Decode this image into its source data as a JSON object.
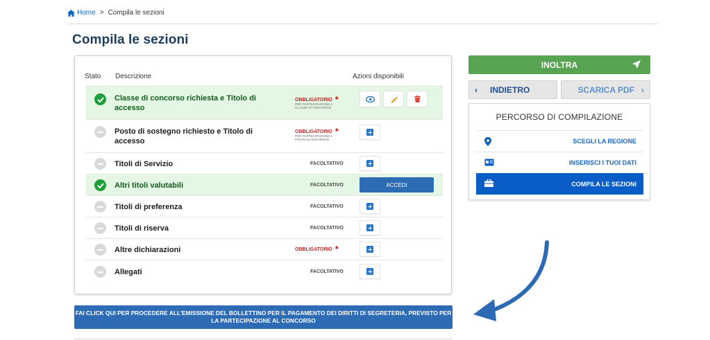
{
  "breadcrumb": {
    "home": "Home",
    "separator": ">",
    "current": "Compila le sezioni"
  },
  "page": {
    "title": "Compila le sezioni"
  },
  "table": {
    "headers": {
      "status": "Stato",
      "description": "Descrizione",
      "actions": "Azioni disponibili"
    },
    "rows": [
      {
        "status": "completed",
        "description": "Classe di concorso richiesta e Titolo di accesso",
        "requirement": "OBBLIGATORIO",
        "requirement_note": "PER PARTECIPAZIONE A CLASSE DI CONCORSO",
        "actions": [
          "view-icon",
          "edit-icon",
          "delete-icon"
        ]
      },
      {
        "status": "pending",
        "description": "Posto di sostegno richiesto e Titolo di accesso",
        "requirement": "OBBLIGATORIO",
        "requirement_note": "PER PARTECIPAZIONE A POSTO DI SOSTEGNO",
        "actions": [
          "add-icon"
        ]
      },
      {
        "status": "pending",
        "description": "Titoli di Servizio",
        "requirement": "FACOLTATIVO",
        "actions": [
          "add-icon"
        ]
      },
      {
        "status": "completed",
        "description": "Altri titoli valutabili",
        "requirement": "FACOLTATIVO",
        "action_label": "ACCEDI"
      },
      {
        "status": "pending",
        "description": "Titoli di preferenza",
        "requirement": "FACOLTATIVO",
        "actions": [
          "add-icon"
        ]
      },
      {
        "status": "pending",
        "description": "Titoli di riserva",
        "requirement": "FACOLTATIVO",
        "actions": [
          "add-icon"
        ]
      },
      {
        "status": "pending",
        "description": "Altre dichiarazioni",
        "requirement": "OBBLIGATORIO",
        "actions": [
          "add-icon"
        ]
      },
      {
        "status": "pending",
        "description": "Allegati",
        "requirement": "FACOLTATIVO",
        "actions": [
          "add-icon"
        ]
      }
    ]
  },
  "sidebar": {
    "forward": "INOLTRA",
    "back": "INDIETRO",
    "download_pdf": "SCARICA PDF",
    "path_title": "PERCORSO DI COMPILAZIONE",
    "steps": [
      {
        "label": "SCEGLI LA REGIONE",
        "icon": "map-pin-icon",
        "active": false
      },
      {
        "label": "INSERISCI I TUOI DATI",
        "icon": "id-card-icon",
        "active": false
      },
      {
        "label": "COMPILA LE SEZIONI",
        "icon": "briefcase-icon",
        "active": true
      }
    ]
  },
  "fee_button": "FAI CLICK QUI PER PROCEDERE ALL'EMISSIONE DEL BOLLETTINO PER IL PAGAMENTO DEI DIRITTI DI SEGRETERIA, PREVISTO PER LA PARTECIPAZIONE AL CONCORSO",
  "colors": {
    "primary": "#2e6bb5",
    "success": "#58a452",
    "required": "#c81e1e",
    "completed_bg": "#e4f7e4",
    "title": "#1f3c5a"
  }
}
